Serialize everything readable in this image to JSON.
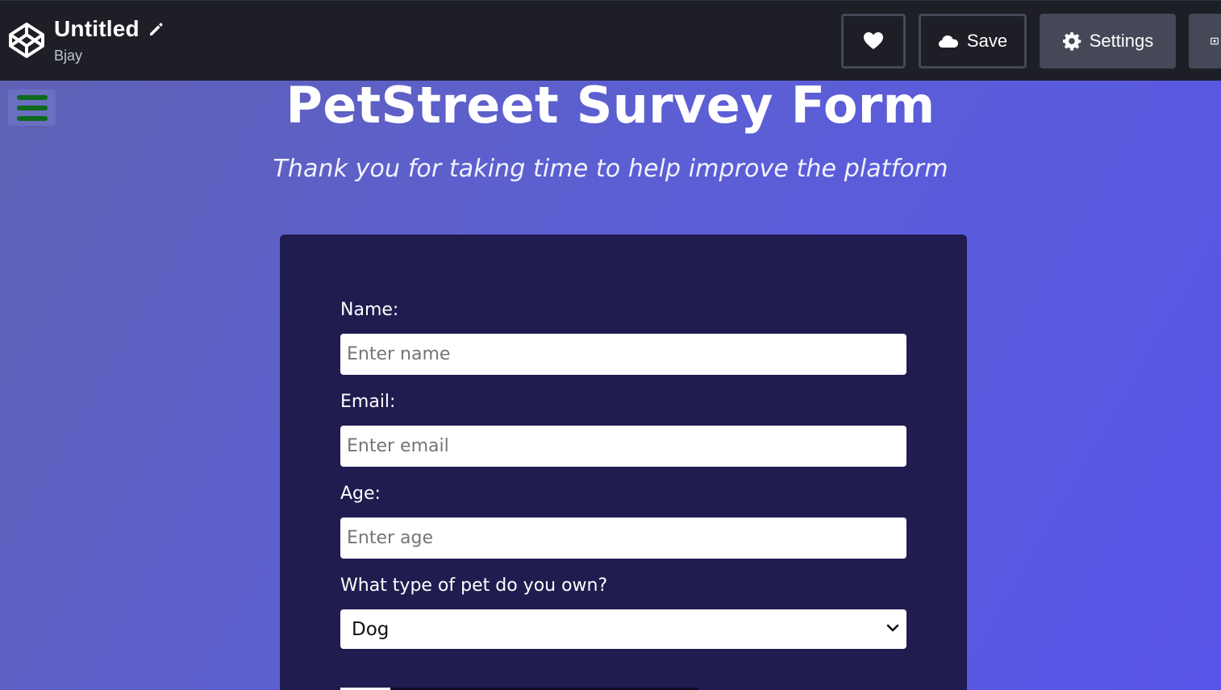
{
  "topbar": {
    "title": "Untitled",
    "author": "Bjay",
    "buttons": {
      "save_label": "Save",
      "settings_label": "Settings"
    }
  },
  "preview": {
    "page_title": "PetStreet Survey Form",
    "subtitle": "Thank you for taking time to help improve the platform",
    "form": {
      "name_label": "Name:",
      "name_placeholder": "Enter name",
      "email_label": "Email:",
      "email_placeholder": "Enter email",
      "age_label": "Age:",
      "age_placeholder": "Enter age",
      "pet_label": "What type of pet do you own?",
      "pet_selected": "Dog"
    }
  },
  "colors": {
    "topbar_bg": "#1e1f26",
    "button_gray": "#444857",
    "card_bg": "#211c4f",
    "gradient_left": "#5f61b4",
    "gradient_right": "#5754e8",
    "hamburger_green": "#0c6b1a"
  },
  "icons": {
    "logo": "codepen-logo-icon",
    "edit": "pencil-icon",
    "like": "heart-icon",
    "save": "cloud-icon",
    "settings": "gear-icon",
    "more": "layout-icon",
    "menu": "hamburger-icon",
    "select": "chevron-down-icon"
  }
}
